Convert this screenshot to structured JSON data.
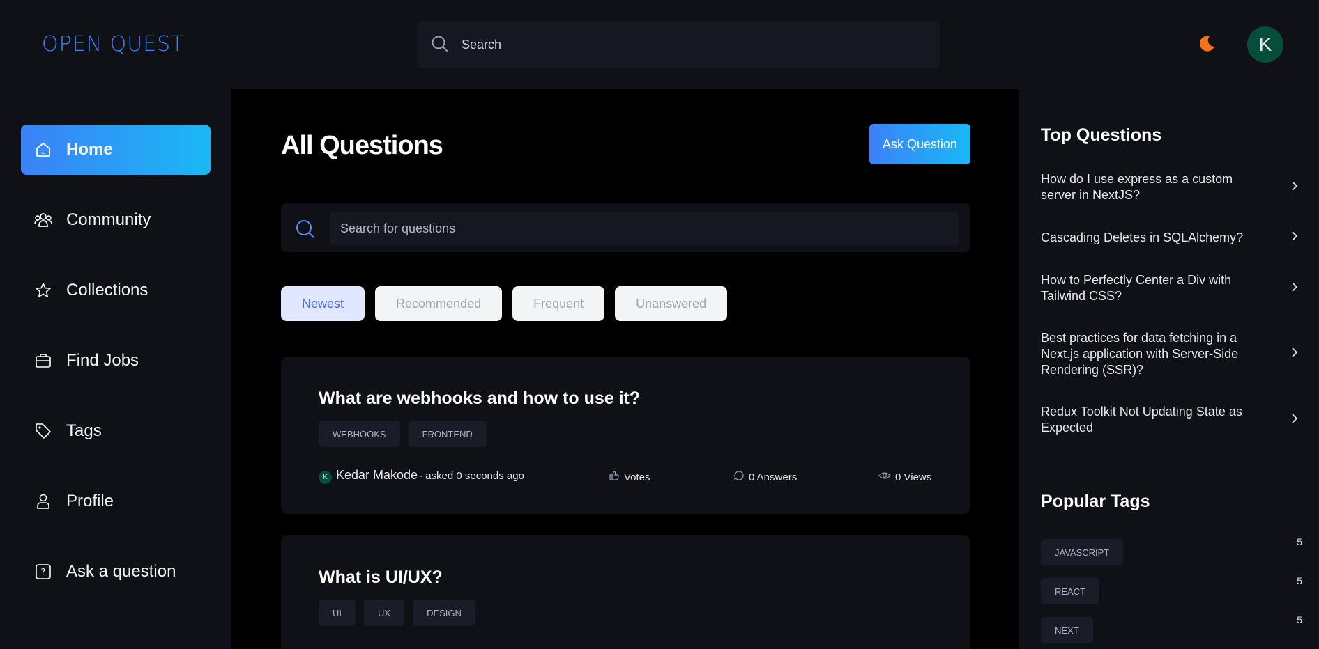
{
  "header": {
    "logo": "OPEN QUEST",
    "search_placeholder": "Search",
    "avatar_initial": "K",
    "colors": {
      "accent": "#3b82f6",
      "accent_end": "#1ab8f5",
      "theme_icon": "#f97316"
    }
  },
  "sidebar": {
    "items": [
      {
        "label": "Home",
        "icon": "home-icon",
        "active": true
      },
      {
        "label": "Community",
        "icon": "users-icon"
      },
      {
        "label": "Collections",
        "icon": "star-icon"
      },
      {
        "label": "Find Jobs",
        "icon": "briefcase-icon"
      },
      {
        "label": "Tags",
        "icon": "tag-icon"
      },
      {
        "label": "Profile",
        "icon": "user-icon"
      },
      {
        "label": "Ask a question",
        "icon": "question-icon"
      }
    ]
  },
  "main": {
    "title": "All Questions",
    "ask_button": "Ask Question",
    "search_placeholder": "Search for questions",
    "filters": [
      "Newest",
      "Recommended",
      "Frequent",
      "Unanswered"
    ],
    "questions": [
      {
        "title": "What are webhooks and how to use it?",
        "tags": [
          "WEBHOOKS",
          "FRONTEND"
        ],
        "author_initial": "K",
        "author": "Kedar Makode",
        "asked": "- asked 0 seconds ago",
        "votes": "Votes",
        "answers": "0 Answers",
        "views": "0 Views"
      },
      {
        "title": "What is UI/UX?",
        "tags": [
          "UI",
          "UX",
          "DESIGN"
        ]
      }
    ]
  },
  "rightbar": {
    "top_questions_title": "Top Questions",
    "top_questions": [
      "How do I use express as a custom server in NextJS?",
      "Cascading Deletes in SQLAlchemy?",
      "How to Perfectly Center a Div with Tailwind CSS?",
      "Best practices for data fetching in a Next.js application with Server-Side Rendering (SSR)?",
      "Redux Toolkit Not Updating State as Expected"
    ],
    "popular_tags_title": "Popular Tags",
    "popular_tags": [
      {
        "name": "JAVASCRIPT",
        "count": "5"
      },
      {
        "name": "REACT",
        "count": "5"
      },
      {
        "name": "NEXT",
        "count": "5"
      }
    ]
  }
}
